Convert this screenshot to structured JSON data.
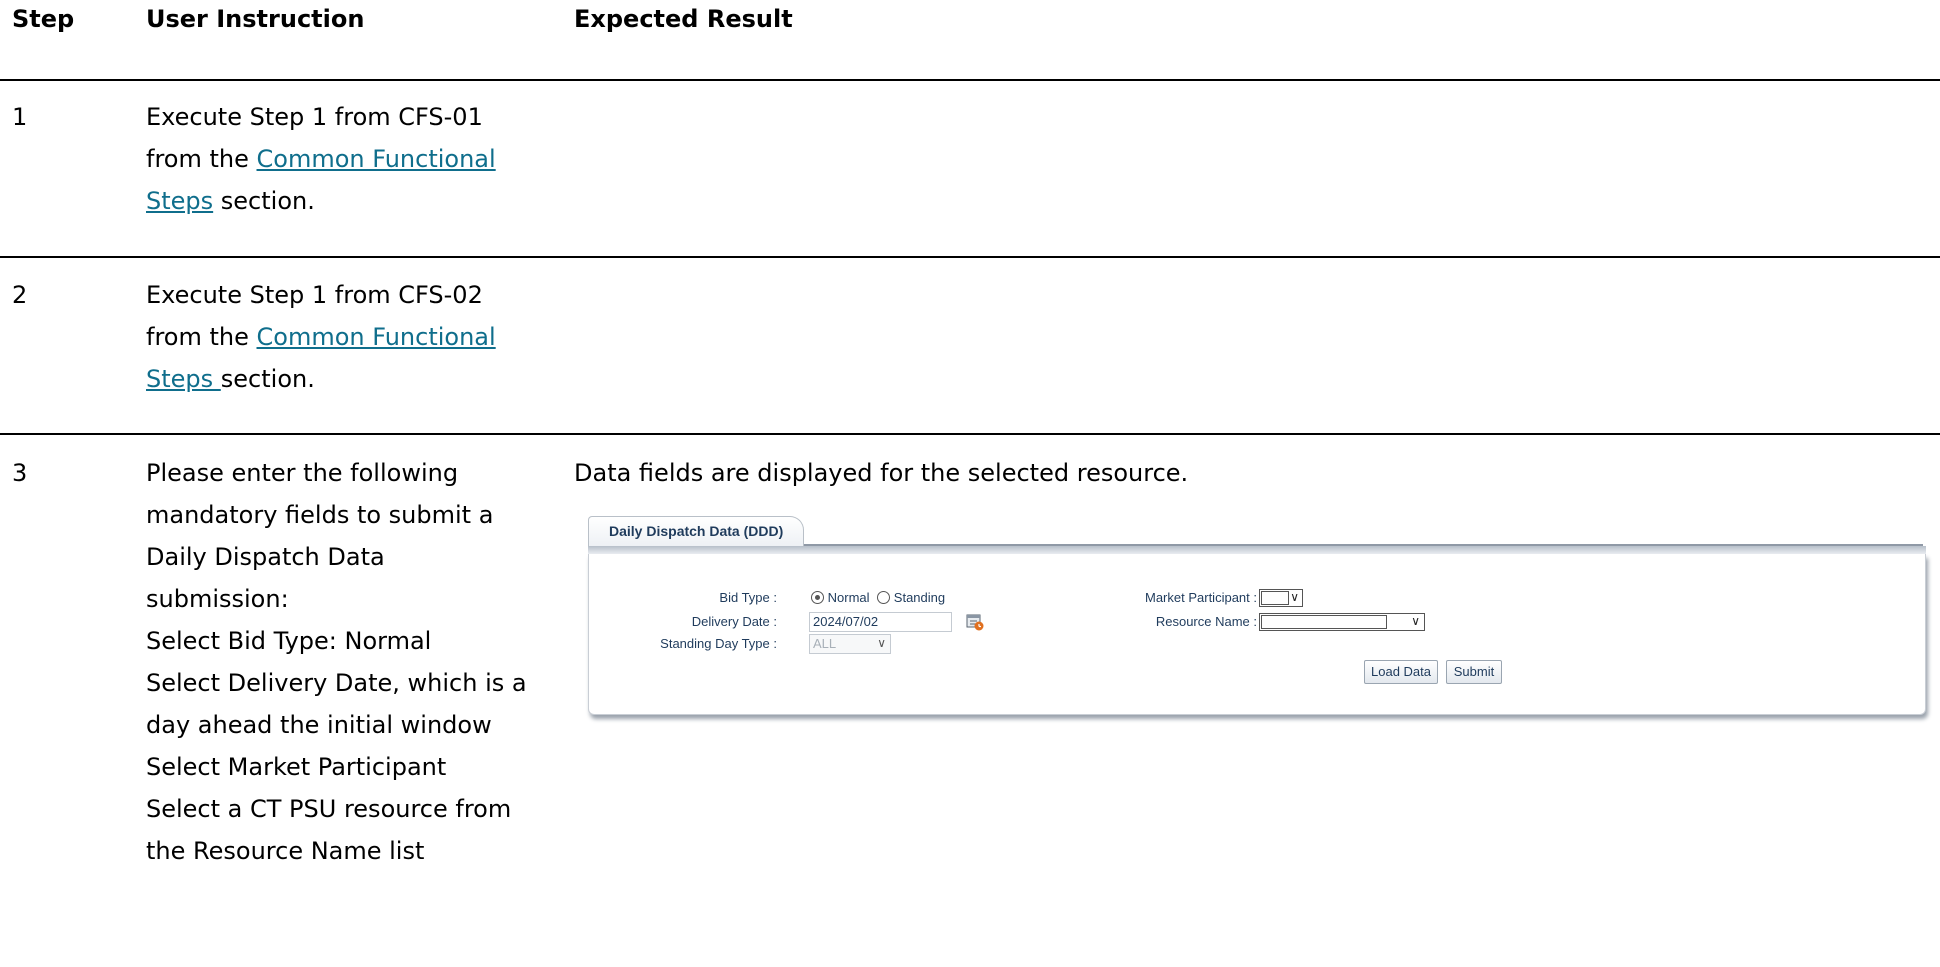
{
  "headers": {
    "step": "Step",
    "instruction": "User Instruction",
    "expected": "Expected Result"
  },
  "rows": [
    {
      "number": "1",
      "line1": "Execute Step 1 from CFS-01",
      "line2_prefix": "from the ",
      "link_part1": "Common Functional",
      "link_part2": "Steps",
      "suffix": " section."
    },
    {
      "number": "2",
      "line1": "Execute Step 1 from CFS-02",
      "line2_prefix": "from the ",
      "link_part1": "Common Functional",
      "link_part2": "Steps ",
      "suffix": "section."
    },
    {
      "number": "3",
      "intro_line1": "Please enter the following",
      "intro_line2": "mandatory fields to submit a",
      "intro_line3": "Daily Dispatch Data",
      "intro_line4": "submission:",
      "item1": "Select Bid Type: Normal",
      "item2_line1": "Select Delivery Date, which is a",
      "item2_line2": "day ahead the initial window",
      "item3": "Select Market Participant",
      "item4_line1": "Select a CT PSU resource from",
      "item4_line2": "the Resource Name list",
      "expected": "Data fields are displayed for the selected resource."
    }
  ],
  "app": {
    "tab_title": "Daily Dispatch Data (DDD)",
    "bid_type_label": "Bid Type :",
    "bid_type_options": [
      "Normal",
      "Standing"
    ],
    "bid_type_selected": "Normal",
    "delivery_date_label": "Delivery Date :",
    "delivery_date_value": "2024/07/02",
    "standing_day_type_label": "Standing Day Type :",
    "standing_day_type_value": "ALL",
    "market_participant_label": "Market Participant :",
    "resource_name_label": "Resource Name :",
    "load_data_button": "Load Data",
    "submit_button": "Submit"
  },
  "colors": {
    "link": "#0f6e8c",
    "app_text": "#1f3b5c"
  }
}
